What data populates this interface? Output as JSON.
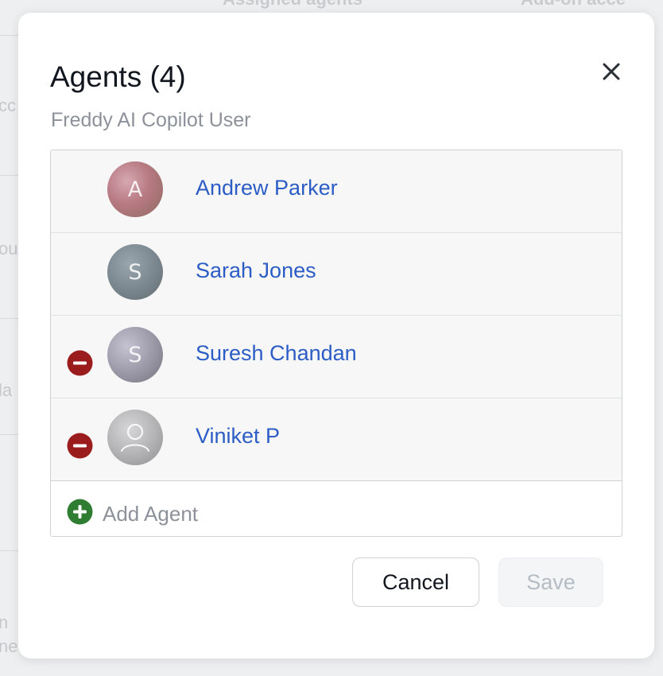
{
  "background": {
    "column_headers": [
      "Assigned agents",
      "Add-on acce"
    ],
    "fragments": [
      "cc",
      "ou",
      "la",
      "n",
      "ne"
    ]
  },
  "modal": {
    "title": "Agents (4)",
    "subtitle": "Freddy AI Copilot User",
    "close_icon": "close-icon",
    "agents": [
      {
        "initial": "A",
        "name": "Andrew Parker",
        "removable": false
      },
      {
        "initial": "S",
        "name": "Sarah Jones",
        "removable": false
      },
      {
        "initial": "S",
        "name": "Suresh Chandan",
        "removable": true
      },
      {
        "initial": "",
        "name": "Viniket P",
        "removable": true,
        "avatar_icon": "user-icon"
      }
    ],
    "add_label": "Add Agent",
    "cancel_label": "Cancel",
    "save_label": "Save"
  },
  "colors": {
    "link": "#2c5cc5",
    "remove": "#9b1c1c",
    "add": "#2e7d32",
    "save_disabled_text": "#b6bcc3"
  }
}
